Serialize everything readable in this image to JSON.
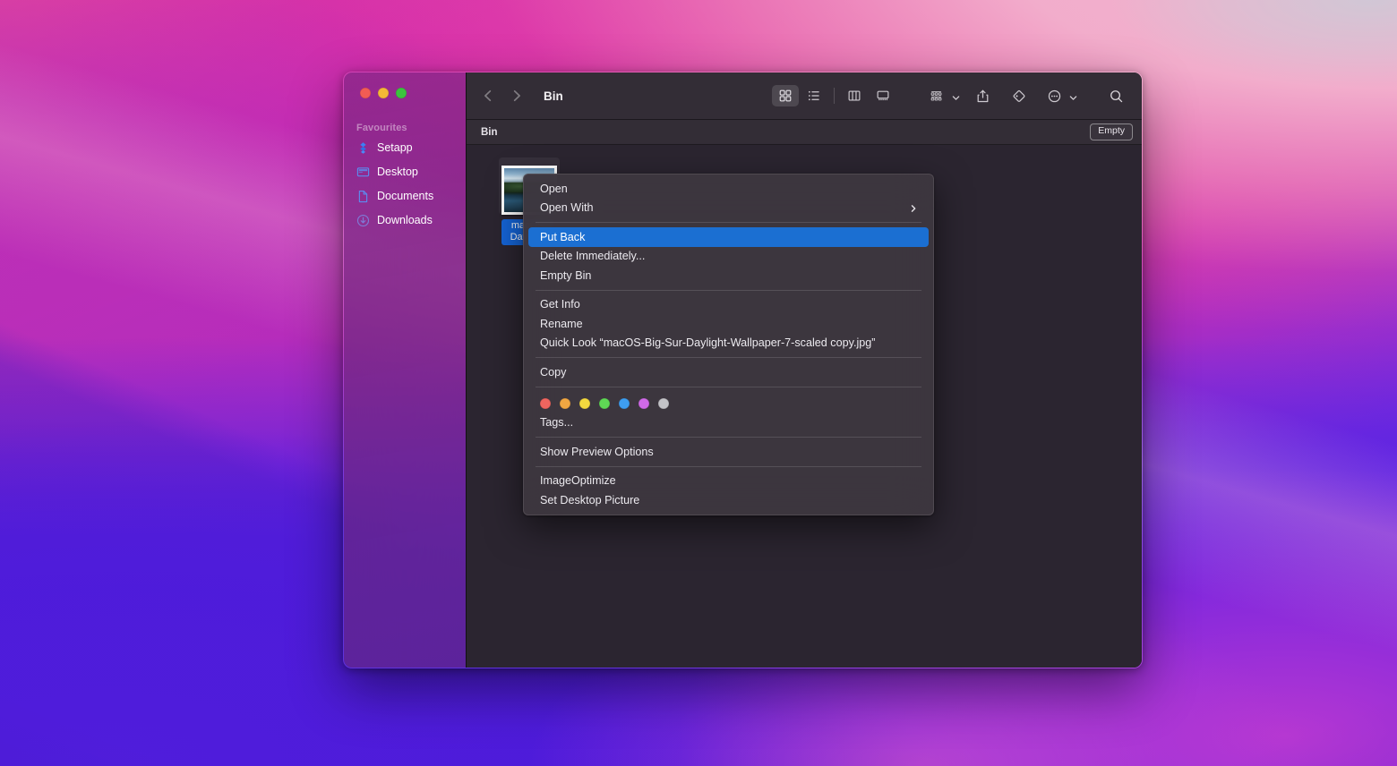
{
  "window": {
    "title": "Bin",
    "traffic_lights": [
      {
        "name": "close",
        "color": "#f25c54"
      },
      {
        "name": "minimize",
        "color": "#f3b936"
      },
      {
        "name": "zoom",
        "color": "#3cc23e"
      }
    ]
  },
  "sidebar": {
    "section_title": "Favourites",
    "items": [
      {
        "label": "Setapp",
        "icon": "setapp-icon"
      },
      {
        "label": "Desktop",
        "icon": "desktop-icon"
      },
      {
        "label": "Documents",
        "icon": "documents-icon"
      },
      {
        "label": "Downloads",
        "icon": "downloads-icon"
      }
    ]
  },
  "toolbar": {
    "back": "back-chevron-icon",
    "forward": "forward-chevron-icon",
    "views": [
      {
        "name": "icon-view",
        "active": true
      },
      {
        "name": "list-view",
        "active": false
      },
      {
        "name": "column-view",
        "active": false
      },
      {
        "name": "gallery-view",
        "active": false
      }
    ],
    "group_by": "group-by-icon",
    "share": "share-icon",
    "tag": "tag-icon",
    "more": "more-actions-icon",
    "search": "search-icon"
  },
  "pathbar": {
    "label": "Bin",
    "empty_button": "Empty"
  },
  "files": [
    {
      "label": "macOS-Big-Sur-Daylight-Wallpaper-7-scaled copy.jpg",
      "label_display": "macOS-\nDaylight.",
      "selected": true
    }
  ],
  "context_menu": {
    "groups": [
      {
        "items": [
          {
            "label": "Open",
            "selected": false,
            "submenu": false
          },
          {
            "label": "Open With",
            "selected": false,
            "submenu": true
          }
        ]
      },
      {
        "items": [
          {
            "label": "Put Back",
            "selected": true,
            "submenu": false
          },
          {
            "label": "Delete Immediately...",
            "selected": false,
            "submenu": false
          },
          {
            "label": "Empty Bin",
            "selected": false,
            "submenu": false
          }
        ]
      },
      {
        "items": [
          {
            "label": "Get Info",
            "selected": false,
            "submenu": false
          },
          {
            "label": "Rename",
            "selected": false,
            "submenu": false
          },
          {
            "label": "Quick Look “macOS-Big-Sur-Daylight-Wallpaper-7-scaled copy.jpg”",
            "selected": false,
            "submenu": false
          }
        ]
      },
      {
        "items": [
          {
            "label": "Copy",
            "selected": false,
            "submenu": false
          }
        ]
      },
      {
        "tags": [
          {
            "name": "red",
            "color": "#f0655f"
          },
          {
            "name": "orange",
            "color": "#f0a742"
          },
          {
            "name": "yellow",
            "color": "#f2d83f"
          },
          {
            "name": "green",
            "color": "#5fd855"
          },
          {
            "name": "blue",
            "color": "#3e9ef0"
          },
          {
            "name": "purple",
            "color": "#d06ae8"
          },
          {
            "name": "gray",
            "color": "#c3c3c7"
          }
        ],
        "items": [
          {
            "label": "Tags...",
            "selected": false,
            "submenu": false
          }
        ]
      },
      {
        "items": [
          {
            "label": "Show Preview Options",
            "selected": false,
            "submenu": false
          }
        ]
      },
      {
        "items": [
          {
            "label": "ImageOptimize",
            "selected": false,
            "submenu": false
          },
          {
            "label": "Set Desktop Picture",
            "selected": false,
            "submenu": false
          }
        ]
      }
    ]
  },
  "colors": {
    "accent_blue": "#1b6fd2",
    "window_bg": "#2b2530",
    "toolbar_bg": "#332d36",
    "menu_bg": "#3c363e",
    "sidebar_tint": "#6a246e"
  }
}
